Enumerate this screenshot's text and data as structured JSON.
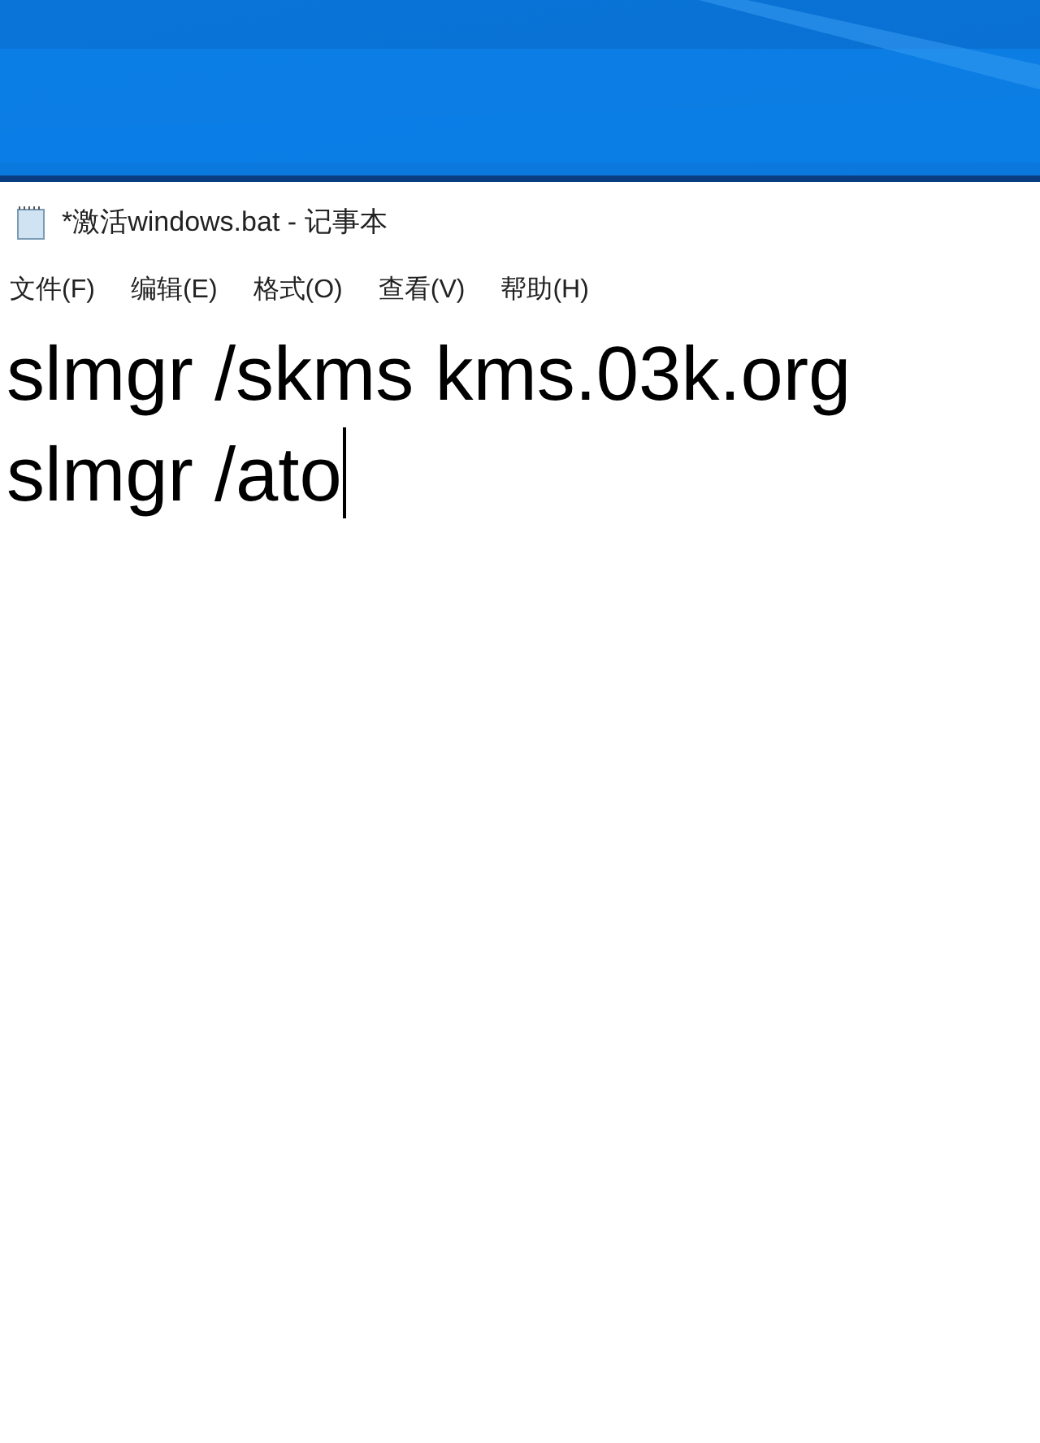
{
  "window": {
    "title": "*激活windows.bat - 记事本"
  },
  "menu": [
    "文件(F)",
    "编辑(E)",
    "格式(O)",
    "查看(V)",
    "帮助(H)"
  ],
  "editor": {
    "lines": [
      "slmgr /skms kms.03k.org",
      "slmgr /ato"
    ]
  }
}
